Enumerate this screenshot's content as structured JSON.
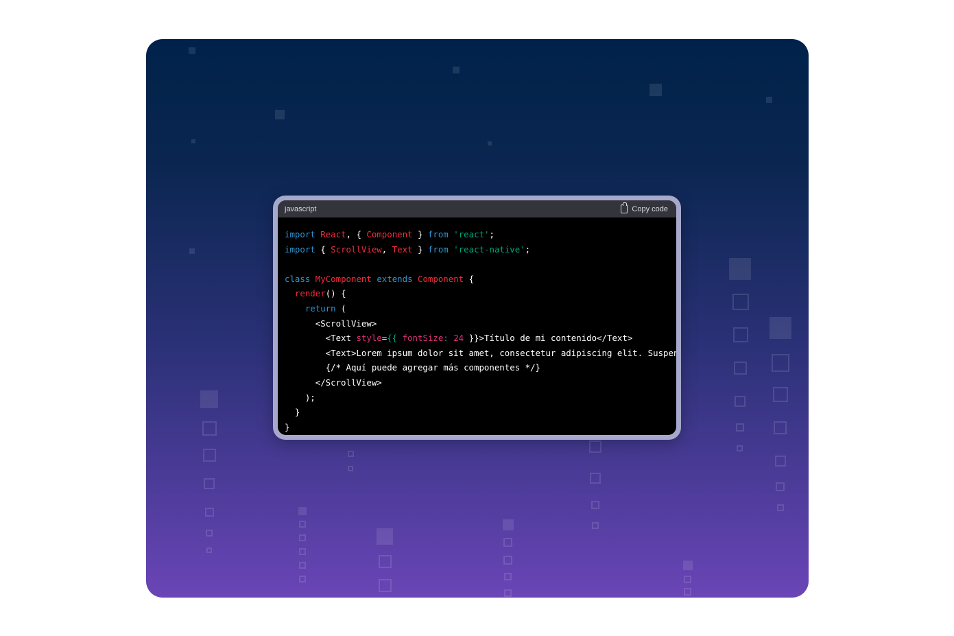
{
  "code_block": {
    "language": "javascript",
    "copy_label": "Copy code",
    "lines": [
      [
        {
          "t": "import",
          "c": "kw"
        },
        {
          "t": " "
        },
        {
          "t": "React",
          "c": "tp"
        },
        {
          "t": ", { "
        },
        {
          "t": "Component",
          "c": "tp"
        },
        {
          "t": " } "
        },
        {
          "t": "from",
          "c": "kw"
        },
        {
          "t": " "
        },
        {
          "t": "'react'",
          "c": "st"
        },
        {
          "t": ";"
        }
      ],
      [
        {
          "t": "import",
          "c": "kw"
        },
        {
          "t": " { "
        },
        {
          "t": "ScrollView",
          "c": "tp"
        },
        {
          "t": ", "
        },
        {
          "t": "Text",
          "c": "tp"
        },
        {
          "t": " } "
        },
        {
          "t": "from",
          "c": "kw"
        },
        {
          "t": " "
        },
        {
          "t": "'react-native'",
          "c": "st"
        },
        {
          "t": ";"
        }
      ],
      [],
      [
        {
          "t": "class",
          "c": "kw"
        },
        {
          "t": " "
        },
        {
          "t": "MyComponent",
          "c": "tp"
        },
        {
          "t": " "
        },
        {
          "t": "extends",
          "c": "kw"
        },
        {
          "t": " "
        },
        {
          "t": "Component",
          "c": "tp"
        },
        {
          "t": " {"
        }
      ],
      [
        {
          "t": "  "
        },
        {
          "t": "render",
          "c": "tp"
        },
        {
          "t": "() {"
        }
      ],
      [
        {
          "t": "    "
        },
        {
          "t": "return",
          "c": "kw"
        },
        {
          "t": " ("
        }
      ],
      [
        {
          "t": "      <ScrollView>"
        }
      ],
      [
        {
          "t": "        <Text "
        },
        {
          "t": "style",
          "c": "at"
        },
        {
          "t": "="
        },
        {
          "t": "{{ ",
          "c": "st"
        },
        {
          "t": "fontSize",
          "c": "at"
        },
        {
          "t": ": ",
          "c": "st"
        },
        {
          "t": "24",
          "c": "at"
        },
        {
          "t": " }}>Título de mi contenido</Text>"
        }
      ],
      [
        {
          "t": "        <Text>Lorem ipsum dolor sit amet, consectetur adipiscing elit. Suspendisse</Text>"
        }
      ],
      [
        {
          "t": "        {/* Aquí puede agregar más componentes */}"
        }
      ],
      [
        {
          "t": "      </ScrollView>"
        }
      ],
      [
        {
          "t": "    );"
        }
      ],
      [
        {
          "t": "  }"
        }
      ],
      [
        {
          "t": "}"
        }
      ]
    ]
  }
}
